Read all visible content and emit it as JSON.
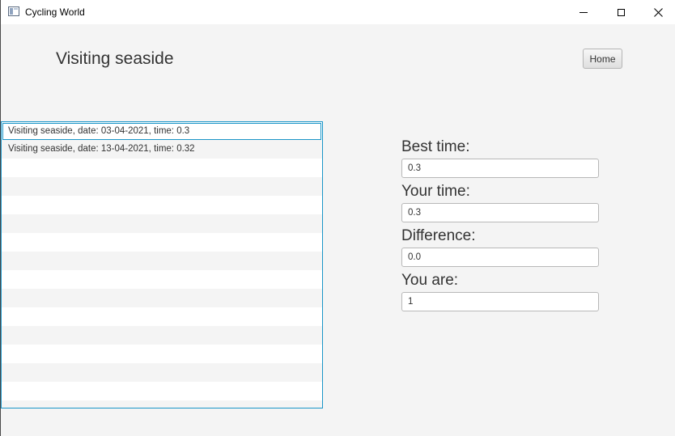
{
  "window": {
    "title": "Cycling World"
  },
  "header": {
    "title": "Visiting seaside",
    "home_label": "Home"
  },
  "rides": {
    "items": [
      "Visiting seaside, date: 03-04-2021, time: 0.3",
      "Visiting seaside, date: 13-04-2021, time: 0.32"
    ],
    "selected_index": 0
  },
  "stats": {
    "best_time_label": "Best time:",
    "best_time_value": "0.3",
    "your_time_label": "Your time:",
    "your_time_value": "0.3",
    "difference_label": "Difference:",
    "difference_value": "0.0",
    "you_are_label": "You are:",
    "you_are_value": "1"
  },
  "colors": {
    "accent": "#1a95c8",
    "background": "#f4f4f4"
  }
}
